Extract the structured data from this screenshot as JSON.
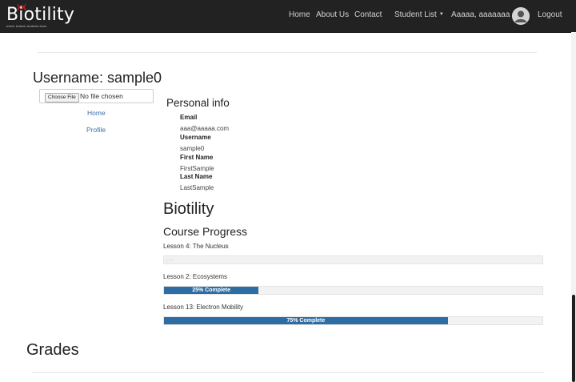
{
  "brand": {
    "name": "Biotility",
    "tagline": "where biotech students learn",
    "accent_color": "#c62828"
  },
  "nav": {
    "links": [
      "Home",
      "About Us",
      "Contact"
    ],
    "student_list": "Student List",
    "user_name": "Aaaaa, aaaaaaa",
    "logout": "Logout",
    "bg_color": "#222222"
  },
  "profile": {
    "username_heading": "Username: sample0",
    "file_button": "Choose File",
    "file_status": "No file chosen",
    "side_links": [
      "Home",
      "Profile"
    ]
  },
  "personal_info": {
    "heading": "Personal info",
    "fields": [
      {
        "label": "Email",
        "value": "aaa@aaaaa.com"
      },
      {
        "label": "Username",
        "value": "sample0"
      },
      {
        "label": "First Name",
        "value": "FirstSample"
      },
      {
        "label": "Last Name",
        "value": "LastSample"
      }
    ]
  },
  "course": {
    "heading": "Biotility",
    "subheading": "Course Progress",
    "lessons": [
      {
        "title": "Lesson 4: The Nucleus",
        "percent": 0,
        "label": "0%"
      },
      {
        "title": "Lesson 2: Ecosystems",
        "percent": 25,
        "label": "25% Complete"
      },
      {
        "title": "Lesson 13: Electron Mobility",
        "percent": 75,
        "label": "75% Complete"
      }
    ],
    "bar_color": "#2e6da4"
  },
  "grades": {
    "heading": "Grades"
  }
}
